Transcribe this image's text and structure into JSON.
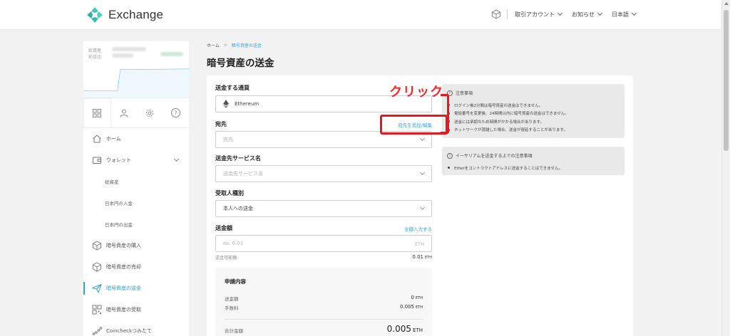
{
  "header": {
    "brand": "Exchange",
    "menu": [
      {
        "label": "取引アカウント"
      },
      {
        "label": "お知らせ"
      },
      {
        "label": "日本語"
      }
    ]
  },
  "sidebar": {
    "asset_labels": [
      "総資産",
      "前日比"
    ],
    "nav": [
      {
        "label": "ホーム",
        "icon": "home-icon"
      },
      {
        "label": "ウォレット",
        "icon": "wallet-icon"
      },
      {
        "label": "総資産"
      },
      {
        "label": "日本円の入金"
      },
      {
        "label": "日本円の出金"
      },
      {
        "label": "暗号資産の購入",
        "icon": "cube-icon"
      },
      {
        "label": "暗号資産の売却",
        "icon": "cube-icon"
      },
      {
        "label": "暗号資産の送金",
        "icon": "send-icon"
      },
      {
        "label": "暗号資産の受取",
        "icon": "qr-icon"
      },
      {
        "label": "Coincheckつみたて",
        "icon": "chart-icon"
      }
    ]
  },
  "breadcrumb": {
    "home": "ホーム",
    "current": "暗号資産の送金"
  },
  "page_title": "暗号資産の送金",
  "form": {
    "currency_label": "送金する通貨",
    "currency_value": "Ethereum",
    "dest_label": "宛先",
    "dest_link": "宛先を追加/編集",
    "dest_placeholder": "宛先",
    "service_label": "送金先サービス名",
    "service_placeholder": "送金先サービス名",
    "recipient_label": "受取人種別",
    "recipient_value": "本人への送金",
    "amount_label": "送金額",
    "amount_link": "全額入力する",
    "amount_placeholder": "ex. 0.01",
    "amount_unit": "ETH",
    "available_label": "送金可能額",
    "available_value": "0.01",
    "available_unit": "ETH"
  },
  "summary": {
    "title": "申請内容",
    "send_label": "送金額",
    "send_value": "0",
    "send_unit": "ETH",
    "fee_label": "手数料",
    "fee_value": "0.005",
    "fee_unit": "ETH",
    "total_label": "合計金額",
    "total_value": "0.005",
    "total_unit": "ETH"
  },
  "notice1": {
    "title": "注意事項",
    "items": [
      "ログイン後2分間は暗号資産の送金はできません。",
      "電話番号を変更後、24時間以内に暗号資産の送金はできません。",
      "送金には承認のため時間がかかる場合があります。",
      "ネットワークが混雑した場合、送金が遅延することがあります。"
    ]
  },
  "notice2": {
    "title": "イーサリアムを送金する上での注意事項",
    "items": [
      "Etherをコントラクトアドレスに送金することはできません。"
    ]
  },
  "annotation": {
    "label": "クリック",
    "color": "#e8181d"
  },
  "colors": {
    "accent": "#2aa6d6",
    "brand": "#3fc8b4"
  }
}
